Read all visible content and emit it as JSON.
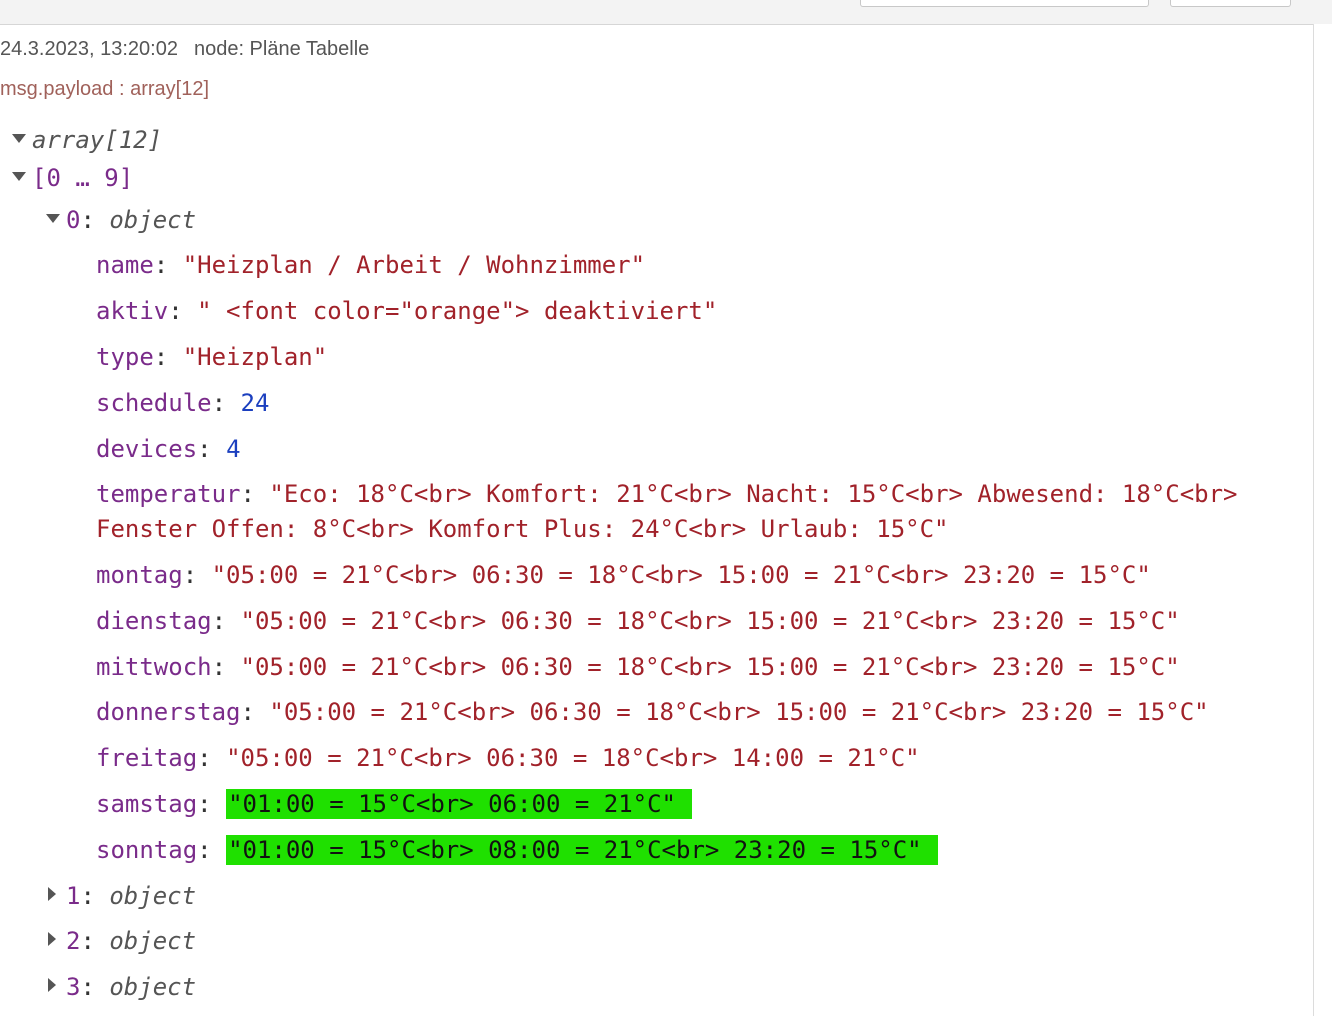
{
  "debug": {
    "timestamp": "24.3.2023, 13:20:02",
    "node": "node: Pläne Tabelle",
    "topic": "msg.payload : array[12]"
  },
  "tree": {
    "root_label": "array[12]",
    "group_label": "[0 … 9]",
    "item0": {
      "index": "0",
      "type": "object",
      "props": [
        {
          "key": "name",
          "value": "\"Heizplan / Arbeit / Wohnzimmer\"",
          "kind": "string"
        },
        {
          "key": "aktiv",
          "value": "\" <font color=\"orange\"> deaktiviert\"",
          "kind": "string"
        },
        {
          "key": "type",
          "value": "\"Heizplan\"",
          "kind": "string"
        },
        {
          "key": "schedule",
          "value": "24",
          "kind": "number"
        },
        {
          "key": "devices",
          "value": "4",
          "kind": "number"
        },
        {
          "key": "temperatur",
          "value": "\"Eco: 18°C<br> Komfort: 21°C<br> Nacht: 15°C<br> Abwesend: 18°C<br> Fenster Offen: 8°C<br> Komfort Plus: 24°C<br> Urlaub: 15°C\"",
          "kind": "string"
        },
        {
          "key": "montag",
          "value": "\"05:00 = 21°C<br> 06:30 = 18°C<br> 15:00 = 21°C<br> 23:20 = 15°C\"",
          "kind": "string"
        },
        {
          "key": "dienstag",
          "value": "\"05:00 = 21°C<br> 06:30 = 18°C<br> 15:00 = 21°C<br> 23:20 = 15°C\"",
          "kind": "string"
        },
        {
          "key": "mittwoch",
          "value": "\"05:00 = 21°C<br> 06:30 = 18°C<br> 15:00 = 21°C<br> 23:20 = 15°C\"",
          "kind": "string"
        },
        {
          "key": "donnerstag",
          "value": "\"05:00 = 21°C<br> 06:30 = 18°C<br> 15:00 = 21°C<br> 23:20 = 15°C\"",
          "kind": "string"
        },
        {
          "key": "freitag",
          "value": "\"05:00 = 21°C<br> 06:30 = 18°C<br> 14:00 = 21°C\"",
          "kind": "string"
        },
        {
          "key": "samstag",
          "value": "\"01:00 = 15°C<br> 06:00 = 21°C\"",
          "kind": "highlight"
        },
        {
          "key": "sonntag",
          "value": "\"01:00 = 15°C<br> 08:00 = 21°C<br> 23:20 = 15°C\"",
          "kind": "highlight"
        }
      ]
    },
    "collapsed_items": [
      {
        "index": "1",
        "type": "object"
      },
      {
        "index": "2",
        "type": "object"
      },
      {
        "index": "3",
        "type": "object"
      }
    ]
  },
  "colors": {
    "highlight": "#1fe000",
    "key": "#7a2b8a",
    "string": "#a1222a",
    "number": "#1b3fbf"
  }
}
